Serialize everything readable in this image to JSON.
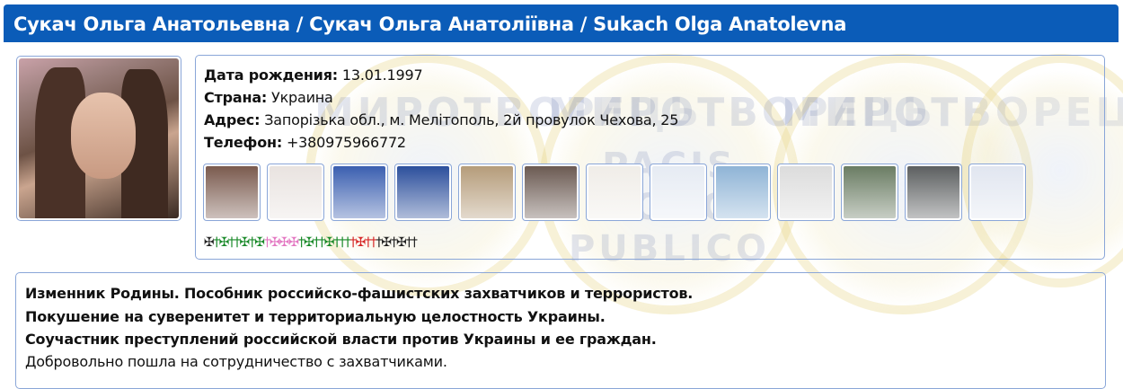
{
  "header": {
    "title": "Сукач Ольга Анатольевна / Сукач Ольга Анатоліївна / Sukach Olga Anatolevna"
  },
  "watermark": {
    "top_text": "МИРОТВОРЕЦЬ",
    "bottom_text": "PACIS BONO PUBLICO"
  },
  "profile": {
    "photo_icon": "person-photo",
    "fields": [
      {
        "label": "Дата рождения:",
        "value": "13.01.1997"
      },
      {
        "label": "Страна:",
        "value": "Украина"
      },
      {
        "label": "Адрес:",
        "value": "Запорізька обл., м. Мелітополь, 2й провулок Чехова, 25"
      },
      {
        "label": "Телефон:",
        "value": "+380975966772"
      }
    ],
    "thumbnails": [
      {
        "name": "thumbnail-1",
        "icon": "portrait-photo",
        "color": "#7a5a4e"
      },
      {
        "name": "thumbnail-2",
        "icon": "profile-page",
        "color": "#e9e3e0"
      },
      {
        "name": "thumbnail-3",
        "icon": "tv-screenshot",
        "color": "#3b5fb0"
      },
      {
        "name": "thumbnail-4",
        "icon": "group-photo",
        "color": "#2c4f9c"
      },
      {
        "name": "thumbnail-5",
        "icon": "meeting-photo",
        "color": "#b59c7a"
      },
      {
        "name": "thumbnail-6",
        "icon": "crowd-photo",
        "color": "#6b5a52"
      },
      {
        "name": "thumbnail-7",
        "icon": "document-scan",
        "color": "#f0ede8"
      },
      {
        "name": "thumbnail-8",
        "icon": "social-page",
        "color": "#e6ebf3"
      },
      {
        "name": "thumbnail-9",
        "icon": "landscape-post",
        "color": "#8fb4d6"
      },
      {
        "name": "thumbnail-10",
        "icon": "quote-post",
        "color": "#dcdcdc"
      },
      {
        "name": "thumbnail-11",
        "icon": "news-photo",
        "color": "#6a7c63"
      },
      {
        "name": "thumbnail-12",
        "icon": "street-photo",
        "color": "#5c5f60"
      },
      {
        "name": "thumbnail-13",
        "icon": "social-post",
        "color": "#e1e6f0"
      }
    ],
    "cross_marks": [
      {
        "char": "✠",
        "color": "#222222"
      },
      {
        "char": "†",
        "color": "#1a8a2a"
      },
      {
        "char": "✠",
        "color": "#1a8a2a"
      },
      {
        "char": "†",
        "color": "#1a8a2a"
      },
      {
        "char": "†",
        "color": "#1a8a2a"
      },
      {
        "char": "✠",
        "color": "#1a8a2a"
      },
      {
        "char": "†",
        "color": "#1a8a2a"
      },
      {
        "char": "✠",
        "color": "#1a8a2a"
      },
      {
        "char": "†",
        "color": "#e377c2"
      },
      {
        "char": "✠",
        "color": "#e377c2"
      },
      {
        "char": "✠",
        "color": "#e377c2"
      },
      {
        "char": "✠",
        "color": "#e377c2"
      },
      {
        "char": "†",
        "color": "#1a8a2a"
      },
      {
        "char": "✠",
        "color": "#1a8a2a"
      },
      {
        "char": "†",
        "color": "#1a8a2a"
      },
      {
        "char": "†",
        "color": "#1a8a2a"
      },
      {
        "char": "✠",
        "color": "#1a8a2a"
      },
      {
        "char": "†",
        "color": "#1a8a2a"
      },
      {
        "char": "†",
        "color": "#1a8a2a"
      },
      {
        "char": "†",
        "color": "#1a8a2a"
      },
      {
        "char": "†",
        "color": "#d62728"
      },
      {
        "char": "✠",
        "color": "#d62728"
      },
      {
        "char": "†",
        "color": "#d62728"
      },
      {
        "char": "†",
        "color": "#d62728"
      },
      {
        "char": "†",
        "color": "#222222"
      },
      {
        "char": "✠",
        "color": "#222222"
      },
      {
        "char": "†",
        "color": "#222222"
      },
      {
        "char": "✠",
        "color": "#222222"
      },
      {
        "char": "†",
        "color": "#222222"
      },
      {
        "char": "†",
        "color": "#222222"
      }
    ]
  },
  "description": {
    "lines": [
      {
        "text": "Изменник Родины. Пособник российско-фашистских захватчиков и террористов.",
        "bold": true
      },
      {
        "text": "Покушение на суверенитет и территориальную целостность Украины.",
        "bold": true
      },
      {
        "text": "Соучастник преступлений российской власти против Украины и ее граждан.",
        "bold": true
      },
      {
        "text": "Добровольно пошла на сотрудничество с захватчиками.",
        "bold": false
      }
    ]
  }
}
